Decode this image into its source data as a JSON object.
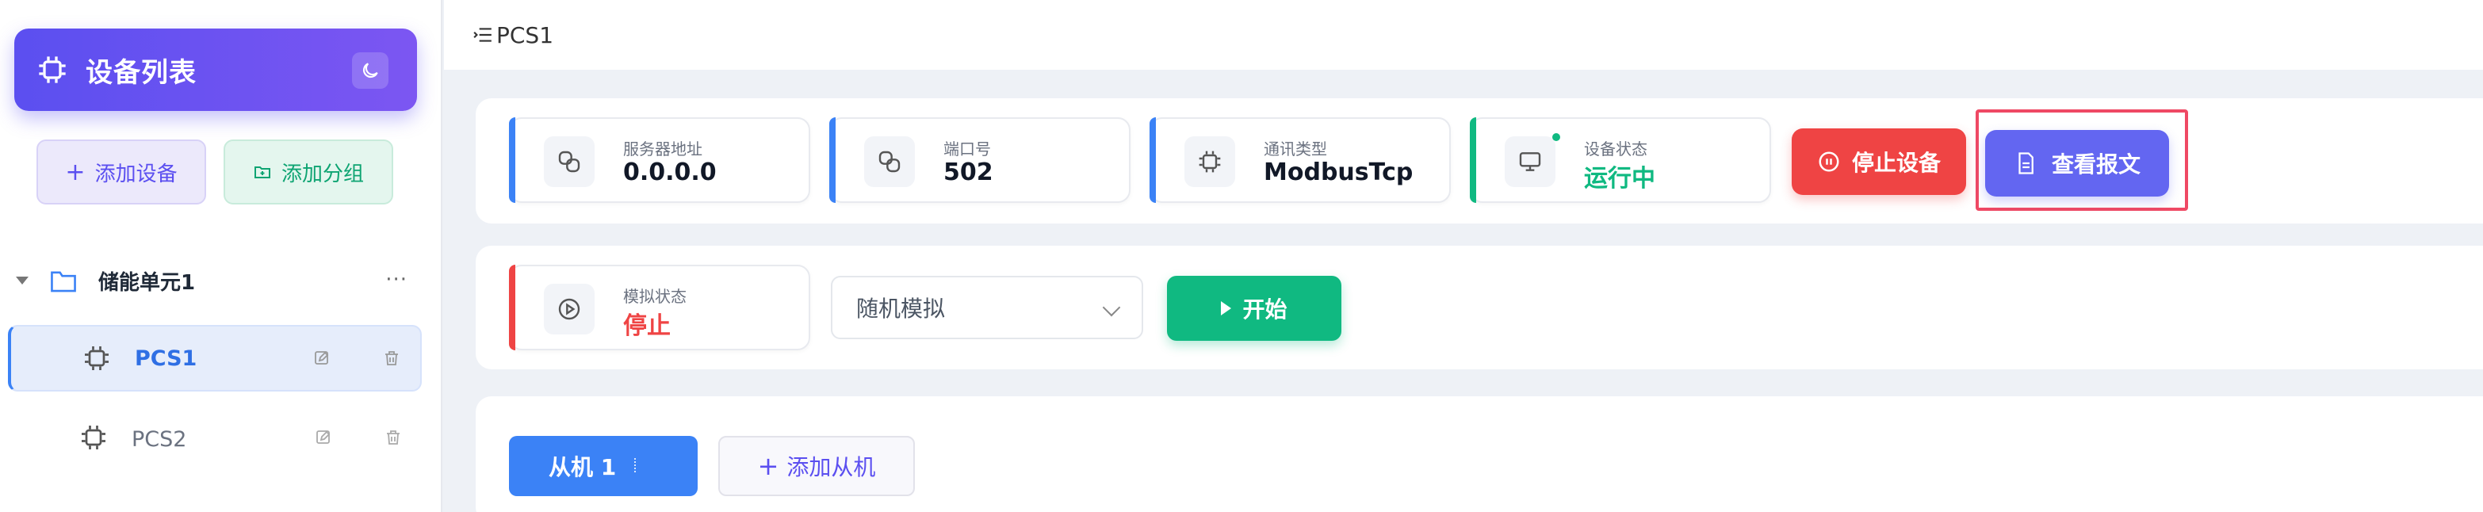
{
  "sidebar": {
    "title": "设备列表",
    "add_device_label": "添加设备",
    "add_group_label": "添加分组",
    "group": {
      "name": "储能单元1",
      "more": "···"
    },
    "devices": [
      {
        "name": "PCS1",
        "active": true
      },
      {
        "name": "PCS2",
        "active": false
      }
    ]
  },
  "topbar": {
    "breadcrumb": "PCS1"
  },
  "info_cards": [
    {
      "label": "服务器地址",
      "value": "0.0.0.0"
    },
    {
      "label": "端口号",
      "value": "502"
    },
    {
      "label": "通讯类型",
      "value": "ModbusTcp"
    },
    {
      "label": "设备状态",
      "value": "运行中"
    }
  ],
  "actions": {
    "stop_label": "停止设备",
    "view_label": "查看报文"
  },
  "simulation": {
    "label": "模拟状态",
    "value": "停止",
    "mode_selected": "随机模拟",
    "start_label": "开始"
  },
  "slaves": {
    "tab_label": "从机 1",
    "add_label": "添加从机"
  },
  "colors": {
    "accent": "#5b4ff0",
    "blue": "#3b82f6",
    "green": "#10b981",
    "red": "#ef4444",
    "indigo": "#6366f1"
  }
}
